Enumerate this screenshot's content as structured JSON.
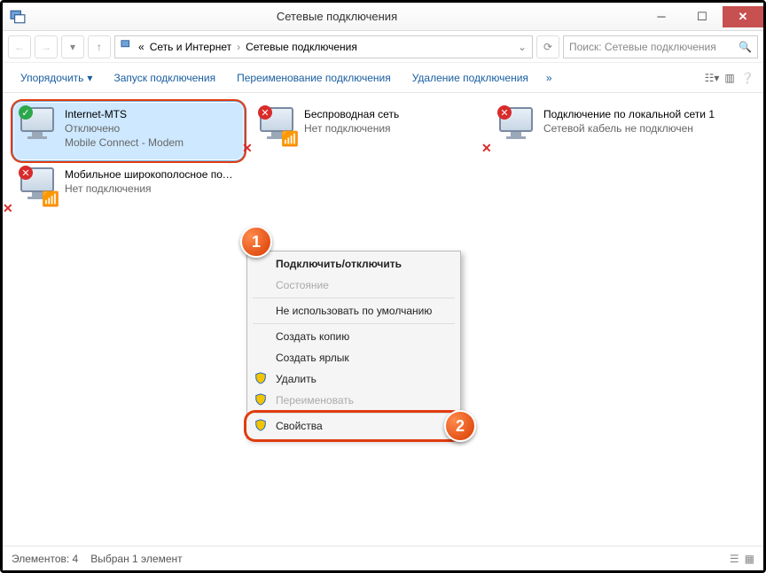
{
  "window": {
    "title": "Сетевые подключения"
  },
  "breadcrumb": {
    "prefix": "«",
    "part1": "Сеть и Интернет",
    "part2": "Сетевые подключения"
  },
  "search": {
    "placeholder": "Поиск: Сетевые подключения"
  },
  "toolbar": {
    "organize": "Упорядочить",
    "start_conn": "Запуск подключения",
    "rename": "Переименование подключения",
    "delete": "Удаление подключения",
    "more": "»"
  },
  "connections": [
    {
      "name": "Internet-MTS",
      "status": "Отключено",
      "detail": "Mobile Connect - Modem",
      "badge": "ok",
      "selected": true,
      "ringed": true,
      "x": false
    },
    {
      "name": "Беспроводная сеть",
      "status": "Нет подключения",
      "detail": "",
      "badge": "err",
      "selected": false,
      "ringed": false,
      "x": true
    },
    {
      "name": "Подключение по локальной сети 1",
      "status": "Сетевой кабель не подключен",
      "detail": "",
      "badge": "err",
      "selected": false,
      "ringed": false,
      "x": true
    },
    {
      "name": "Мобильное широкополосное подключение",
      "status": "Нет подключения",
      "detail": "",
      "badge": "err",
      "selected": false,
      "ringed": false,
      "x": true
    }
  ],
  "context_menu": {
    "connect_toggle": "Подключить/отключить",
    "state": "Состояние",
    "not_default": "Не использовать по умолчанию",
    "copy": "Создать копию",
    "shortcut": "Создать ярлык",
    "delete": "Удалить",
    "rename": "Переименовать",
    "properties": "Свойства"
  },
  "callouts": {
    "one": "1",
    "two": "2"
  },
  "statusbar": {
    "elements": "Элементов: 4",
    "selected": "Выбран 1 элемент"
  }
}
